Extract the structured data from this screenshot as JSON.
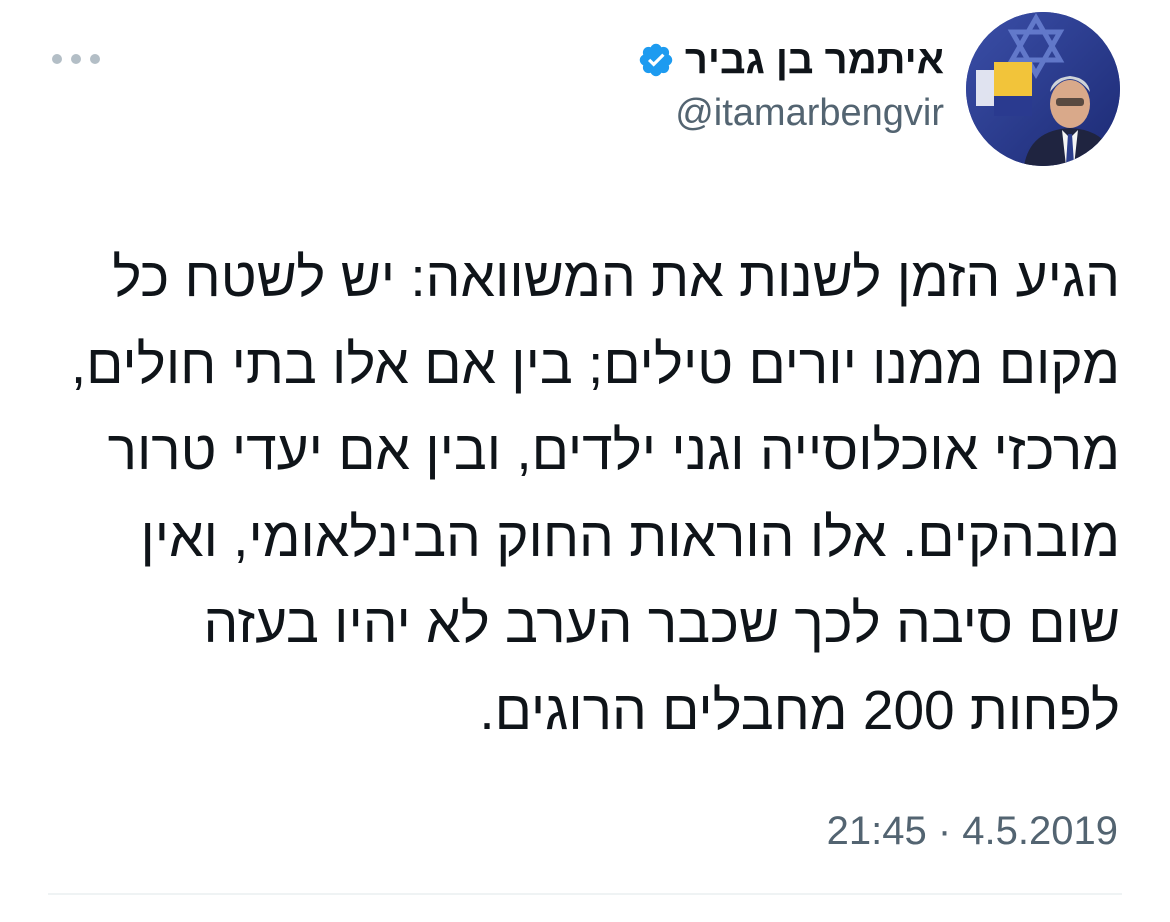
{
  "tweet": {
    "author": {
      "display_name": "איתמר בן גביר",
      "handle": "@itamarbengvir",
      "verified": true,
      "verified_icon": "verified-badge-icon",
      "avatar_icon": "profile-avatar"
    },
    "more_icon": "more-options-icon",
    "body_lines": [
      "הגיע הזמן לשנות את המשוואה: יש לשטח כל",
      "מקום ממנו יורים טילים; בין אם אלו בתי חולים,",
      "מרכזי אוכלוסייה וגני ילדים, ובין אם יעדי טרור",
      "מובהקים. אלו הוראות החוק הבינלאומי, ואין",
      "שום סיבה לכך שכבר הערב לא יהיו בעזה",
      "לפחות 200 מחבלים הרוגים."
    ],
    "time": "21:45",
    "separator": "·",
    "date": "4.5.2019"
  },
  "colors": {
    "text_primary": "#0f1419",
    "text_secondary": "#536471",
    "verified_blue": "#1d9bf0",
    "divider": "#eff3f4",
    "more_dots": "#b3bec6"
  }
}
